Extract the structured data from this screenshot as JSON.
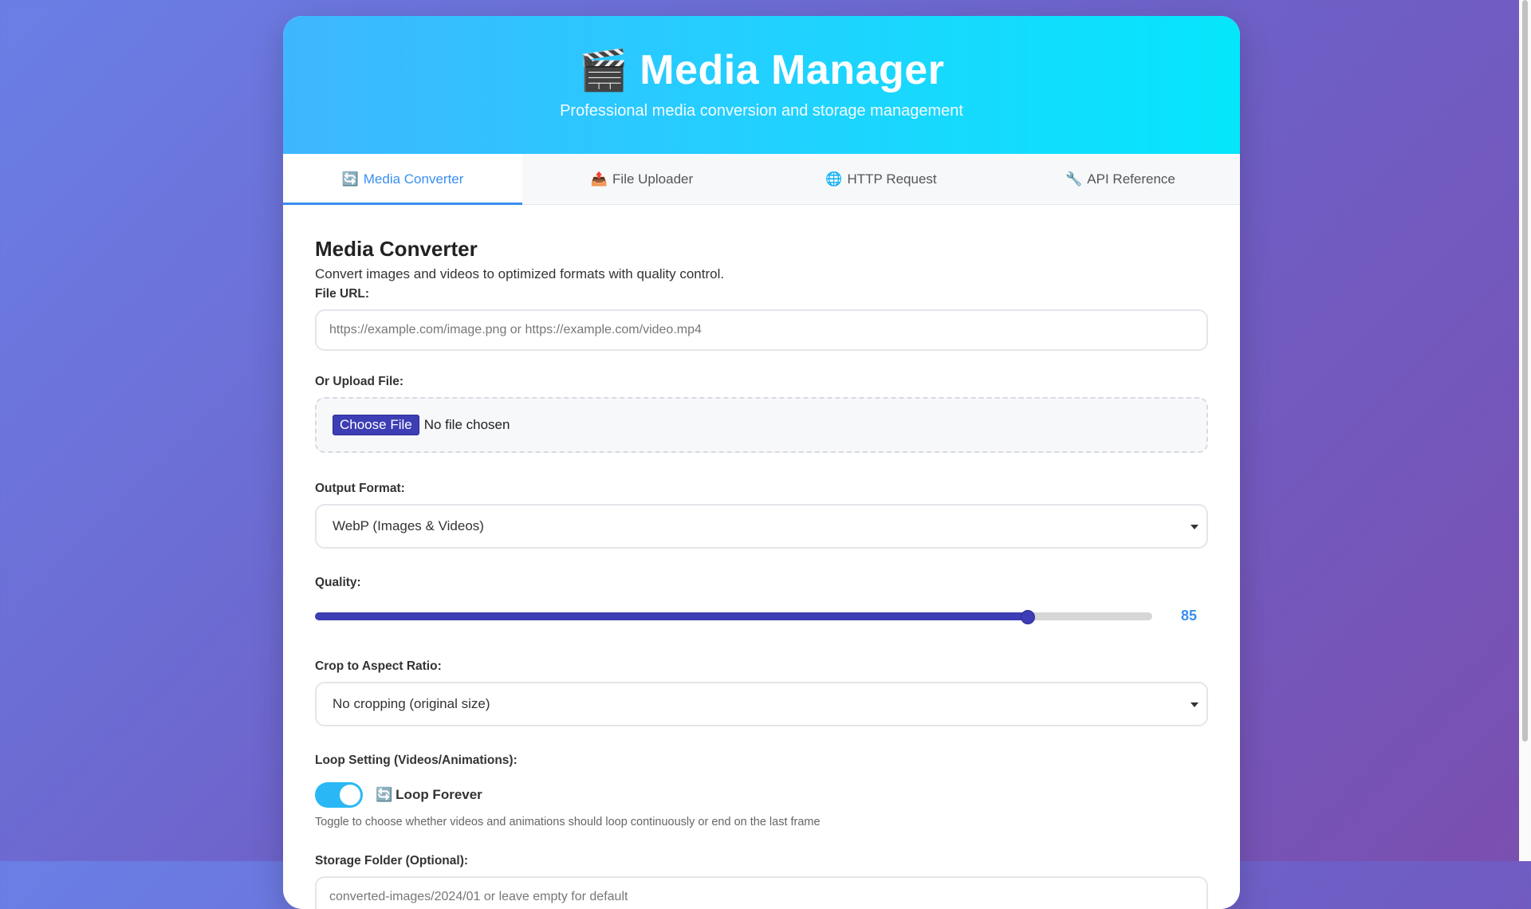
{
  "header": {
    "emoji": "🎬",
    "title": "Media Manager",
    "subtitle": "Professional media conversion and storage management"
  },
  "tabs": [
    {
      "icon": "🔄",
      "label": "Media Converter",
      "active": true
    },
    {
      "icon": "📤",
      "label": "File Uploader",
      "active": false
    },
    {
      "icon": "🌐",
      "label": "HTTP Request",
      "active": false
    },
    {
      "icon": "🔧",
      "label": "API Reference",
      "active": false
    }
  ],
  "section": {
    "title": "Media Converter",
    "description": "Convert images and videos to optimized formats with quality control."
  },
  "form": {
    "file_url": {
      "label": "File URL:",
      "placeholder": "https://example.com/image.png or https://example.com/video.mp4"
    },
    "upload": {
      "label": "Or Upload File:",
      "button": "Choose File",
      "status": "No file chosen"
    },
    "output_format": {
      "label": "Output Format:",
      "selected": "WebP (Images & Videos)"
    },
    "quality": {
      "label": "Quality:",
      "value": 85,
      "min": 0,
      "max": 100,
      "display": "85"
    },
    "crop": {
      "label": "Crop to Aspect Ratio:",
      "selected": "No cropping (original size)"
    },
    "loop": {
      "label": "Loop Setting (Videos/Animations):",
      "icon": "🔄",
      "toggle_label": "Loop Forever",
      "on": true,
      "help": "Toggle to choose whether videos and animations should loop continuously or end on the last frame"
    },
    "storage": {
      "label": "Storage Folder (Optional):",
      "placeholder": "converted-images/2024/01 or leave empty for default"
    }
  },
  "colors": {
    "accent": "#3a8ff0",
    "slider": "#3d3db5",
    "toggle": "#29b8f5"
  }
}
